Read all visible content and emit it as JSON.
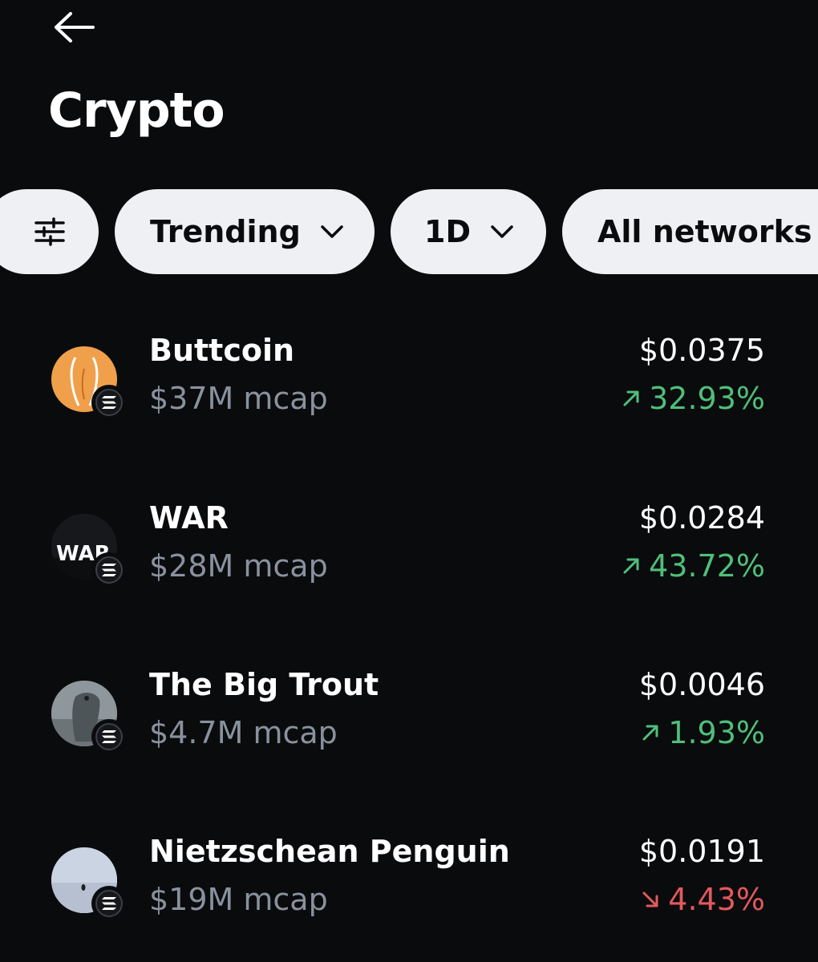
{
  "header": {
    "title": "Crypto"
  },
  "filters": {
    "sort_label": "Trending",
    "period_label": "1D",
    "network_label": "All networks"
  },
  "assets": [
    {
      "name": "Buttcoin",
      "mcap": "$37M mcap",
      "price": "$0.0375",
      "change": "32.93%",
      "direction": "up",
      "network_icon": "solana-icon",
      "avatar_color": "#f0a04b"
    },
    {
      "name": "WAR",
      "mcap": "$28M mcap",
      "price": "$0.0284",
      "change": "43.72%",
      "direction": "up",
      "network_icon": "solana-icon",
      "avatar_text": "WAR"
    },
    {
      "name": "The Big Trout",
      "mcap": "$4.7M mcap",
      "price": "$0.0046",
      "change": "1.93%",
      "direction": "up",
      "network_icon": "solana-icon"
    },
    {
      "name": "Nietzschean Penguin",
      "mcap": "$19M mcap",
      "price": "$0.0191",
      "change": "4.43%",
      "direction": "down",
      "network_icon": "solana-icon"
    }
  ],
  "colors": {
    "background": "#0a0b0d",
    "pill": "#eef0f3",
    "secondary_text": "#8a919e",
    "positive": "#4fbf7a",
    "negative": "#e2595c"
  }
}
